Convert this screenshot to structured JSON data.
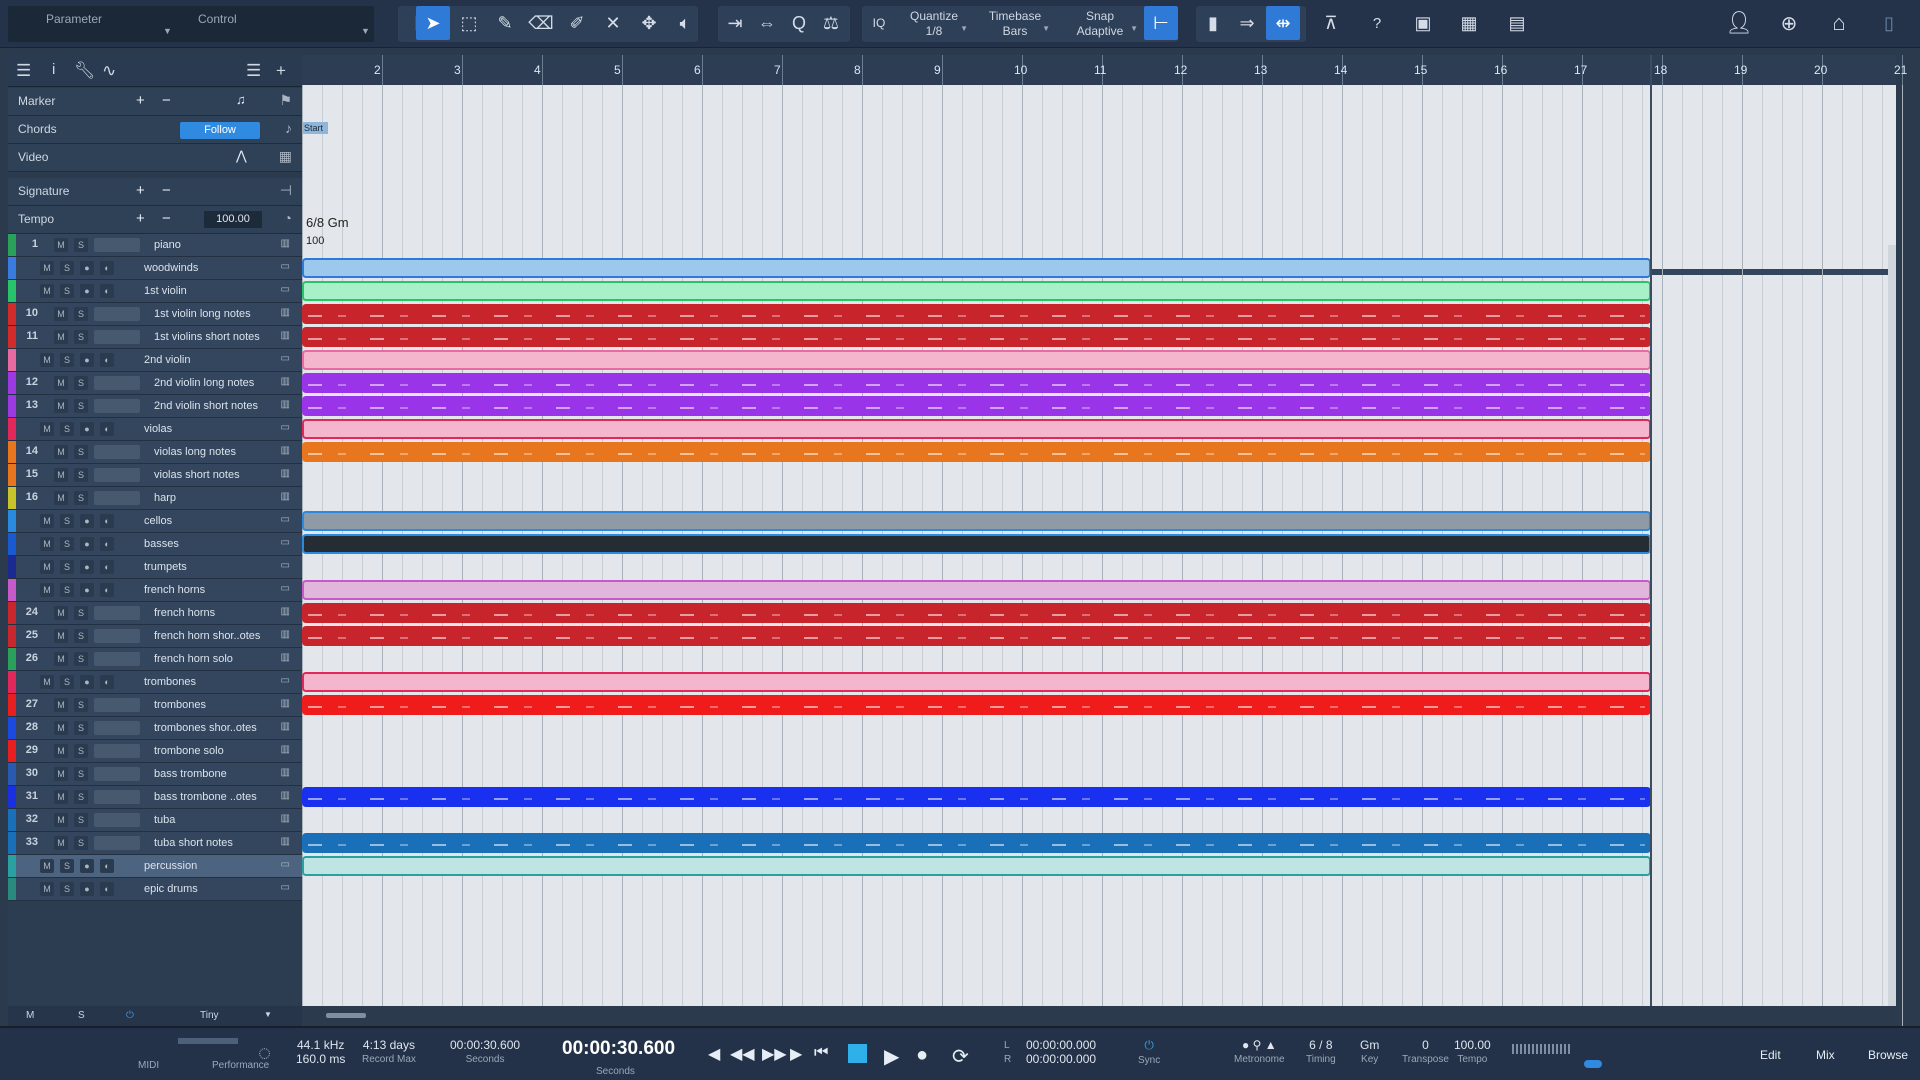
{
  "topbar": {
    "parameter_label": "Parameter",
    "control_label": "Control",
    "iq_label": "IQ",
    "quantize": {
      "label": "Quantize",
      "value": "1/8"
    },
    "timebase": {
      "label": "Timebase",
      "value": "Bars"
    },
    "snap": {
      "label": "Snap",
      "value": "Adaptive"
    },
    "help_label": "?"
  },
  "global_tracks": {
    "marker": "Marker",
    "chords": "Chords",
    "chords_button": "Follow",
    "video": "Video",
    "signature": "Signature",
    "tempo": "Tempo",
    "tempo_value": "100.00"
  },
  "ruler": {
    "bars": [
      "2",
      "3",
      "4",
      "5",
      "6",
      "7",
      "8",
      "9",
      "10",
      "11",
      "12",
      "13",
      "14",
      "15",
      "16",
      "17",
      "18",
      "19",
      "20",
      "21"
    ]
  },
  "arrange": {
    "start_marker": "Start",
    "signature_text": "6/8  Gm",
    "tempo_text": "100"
  },
  "tracks": [
    {
      "num": "1",
      "name": "piano",
      "type": "inst",
      "color": "#2aa05a"
    },
    {
      "num": "",
      "name": "woodwinds",
      "type": "folder",
      "color": "#3a7be0"
    },
    {
      "num": "",
      "name": "1st violin",
      "type": "folder",
      "color": "#29c46a"
    },
    {
      "num": "10",
      "name": "1st violin long notes",
      "type": "inst",
      "color": "#d12b2b"
    },
    {
      "num": "11",
      "name": "1st violins short notes",
      "type": "inst",
      "color": "#d12b2b"
    },
    {
      "num": "",
      "name": "2nd violin",
      "type": "folder",
      "color": "#e86aa0"
    },
    {
      "num": "12",
      "name": "2nd violin long notes",
      "type": "inst",
      "color": "#9b3ae0"
    },
    {
      "num": "13",
      "name": "2nd violin short notes",
      "type": "inst",
      "color": "#9b3ae0"
    },
    {
      "num": "",
      "name": "violas",
      "type": "folder",
      "color": "#e0285a"
    },
    {
      "num": "14",
      "name": "violas long notes",
      "type": "inst",
      "color": "#e8761e"
    },
    {
      "num": "15",
      "name": "violas short notes",
      "type": "inst",
      "color": "#e8761e"
    },
    {
      "num": "16",
      "name": "harp",
      "type": "inst",
      "color": "#c6c42a"
    },
    {
      "num": "",
      "name": "cellos",
      "type": "folder",
      "color": "#2a8ae0"
    },
    {
      "num": "",
      "name": "basses",
      "type": "folder",
      "color": "#1a5ad0"
    },
    {
      "num": "",
      "name": "trumpets",
      "type": "folder",
      "color": "#1a2a90"
    },
    {
      "num": "",
      "name": "french horns",
      "type": "folder",
      "color": "#c65ac8"
    },
    {
      "num": "24",
      "name": "french horns",
      "type": "inst",
      "color": "#c8272e"
    },
    {
      "num": "25",
      "name": "french horn shor..otes",
      "type": "inst",
      "color": "#c8272e"
    },
    {
      "num": "26",
      "name": "french horn solo",
      "type": "inst",
      "color": "#2aa05a"
    },
    {
      "num": "",
      "name": "trombones",
      "type": "folder",
      "color": "#e0285a"
    },
    {
      "num": "27",
      "name": "trombones",
      "type": "inst",
      "color": "#e62020"
    },
    {
      "num": "28",
      "name": "trombones shor..otes",
      "type": "inst",
      "color": "#1a4ae0"
    },
    {
      "num": "29",
      "name": "trombone solo",
      "type": "inst",
      "color": "#e62020"
    },
    {
      "num": "30",
      "name": "bass trombone",
      "type": "inst",
      "color": "#2a5ab0"
    },
    {
      "num": "31",
      "name": "bass trombone ..otes",
      "type": "inst",
      "color": "#1a30e0"
    },
    {
      "num": "32",
      "name": "tuba",
      "type": "inst",
      "color": "#1a70b8"
    },
    {
      "num": "33",
      "name": "tuba  short notes",
      "type": "inst",
      "color": "#1a70b8"
    },
    {
      "num": "",
      "name": "percussion",
      "type": "folder",
      "color": "#2aa0a0",
      "selected": true
    },
    {
      "num": "",
      "name": "epic drums",
      "type": "folder",
      "color": "#2a8a80"
    }
  ],
  "clips": [
    {
      "row": 1,
      "color": "#9cc8ee",
      "border": "#2f7ad6",
      "lines": false
    },
    {
      "row": 2,
      "color": "#a8f0c8",
      "border": "#29c46a",
      "lines": false
    },
    {
      "row": 3,
      "color": "#c8242c",
      "border": "#c8242c",
      "lines": true
    },
    {
      "row": 4,
      "color": "#c8242c",
      "border": "#c8242c",
      "lines": true
    },
    {
      "row": 5,
      "color": "#f4b6cc",
      "border": "#e86aa0",
      "lines": false
    },
    {
      "row": 6,
      "color": "#9a34e8",
      "border": "#9a34e8",
      "lines": true
    },
    {
      "row": 7,
      "color": "#9a34e8",
      "border": "#9a34e8",
      "lines": true
    },
    {
      "row": 8,
      "color": "#f4b6cc",
      "border": "#e0285a",
      "lines": false
    },
    {
      "row": 9,
      "color": "#e8761e",
      "border": "#e8761e",
      "lines": true
    },
    {
      "row": 12,
      "color": "#8e9aa6",
      "border": "#2a8ae0",
      "lines": false
    },
    {
      "row": 13,
      "color": "#262c34",
      "border": "#2a8ae0",
      "lines": false
    },
    {
      "row": 15,
      "color": "#e0b6dc",
      "border": "#c65ac8",
      "lines": false
    },
    {
      "row": 16,
      "color": "#c8242c",
      "border": "#c8242c",
      "lines": true
    },
    {
      "row": 17,
      "color": "#c8242c",
      "border": "#c8242c",
      "lines": true
    },
    {
      "row": 19,
      "color": "#f4b6cc",
      "border": "#e0285a",
      "lines": false
    },
    {
      "row": 20,
      "color": "#f01c1c",
      "border": "#f01c1c",
      "lines": true
    },
    {
      "row": 24,
      "color": "#1a30f0",
      "border": "#1a30f0",
      "lines": true
    },
    {
      "row": 26,
      "color": "#1a70b8",
      "border": "#1a70b8",
      "lines": true
    },
    {
      "row": 27,
      "color": "#bfe4e4",
      "border": "#2aa0a0",
      "lines": false
    }
  ],
  "left_bottom": {
    "m": "M",
    "s": "S",
    "size": "Tiny"
  },
  "transport": {
    "midi": "MIDI",
    "performance": "Performance",
    "sample_rate": "44.1 kHz",
    "latency": "160.0 ms",
    "record_max_value": "4:13 days",
    "record_max_label": "Record Max",
    "secondary_time": "00:00:30.600",
    "secondary_time_label": "Seconds",
    "main_time": "00:00:30.600",
    "main_time_label": "Seconds",
    "loop_l": "00:00:00.000",
    "loop_r": "00:00:00.000",
    "sync": "Sync",
    "metronome": "Metronome",
    "timing_value": "6 / 8",
    "timing_label": "Timing",
    "key_value": "Gm",
    "key_label": "Key",
    "transpose_value": "0",
    "transpose_label": "Transpose",
    "tempo_value": "100.00",
    "tempo_label": "Tempo",
    "edit": "Edit",
    "mix": "Mix",
    "browse": "Browse"
  }
}
